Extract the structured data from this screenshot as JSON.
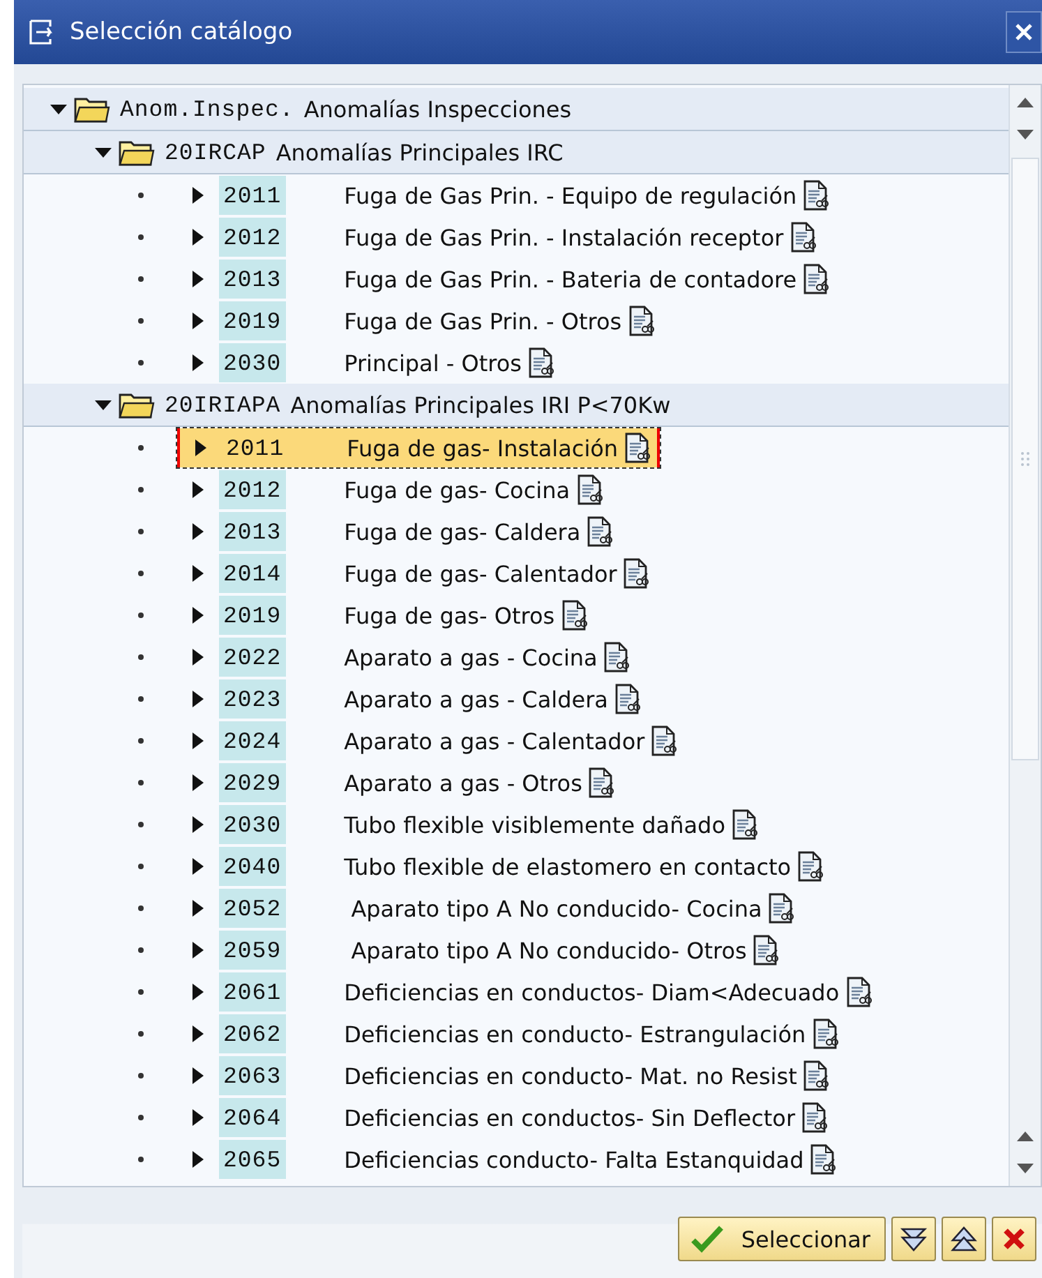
{
  "window": {
    "title": "Selección catálogo"
  },
  "tree": [
    {
      "code": "Anom.Inspec.",
      "text": "Anomalías Inspecciones",
      "expanded": true,
      "selected": false,
      "children": [
        {
          "code": "20IRCAP",
          "text": "Anomalías Principales IRC",
          "expanded": true,
          "selected": false,
          "children": [
            {
              "code": "2011",
              "text": "Fuga de Gas Prin. - Equipo de regulación",
              "expanded": false,
              "selected": false
            },
            {
              "code": "2012",
              "text": "Fuga de Gas Prin. - Instalación receptor",
              "expanded": false,
              "selected": false
            },
            {
              "code": "2013",
              "text": "Fuga de Gas Prin. - Bateria de contadore",
              "expanded": false,
              "selected": false
            },
            {
              "code": "2019",
              "text": "Fuga de Gas Prin. - Otros",
              "expanded": false,
              "selected": false
            },
            {
              "code": "2030",
              "text": "Principal - Otros",
              "expanded": false,
              "selected": false
            }
          ]
        },
        {
          "code": "20IRIAPA",
          "text": "Anomalías Principales IRI P<70Kw",
          "expanded": true,
          "selected": false,
          "children": [
            {
              "code": "2011",
              "text": "Fuga de gas- Instalación",
              "expanded": false,
              "selected": true
            },
            {
              "code": "2012",
              "text": "Fuga de gas- Cocina",
              "expanded": false,
              "selected": false
            },
            {
              "code": "2013",
              "text": "Fuga de gas- Caldera",
              "expanded": false,
              "selected": false
            },
            {
              "code": "2014",
              "text": "Fuga de gas- Calentador",
              "expanded": false,
              "selected": false
            },
            {
              "code": "2019",
              "text": "Fuga de gas- Otros",
              "expanded": false,
              "selected": false
            },
            {
              "code": "2022",
              "text": "Aparato a gas - Cocina",
              "expanded": false,
              "selected": false
            },
            {
              "code": "2023",
              "text": "Aparato a gas - Caldera",
              "expanded": false,
              "selected": false
            },
            {
              "code": "2024",
              "text": "Aparato a gas - Calentador",
              "expanded": false,
              "selected": false
            },
            {
              "code": "2029",
              "text": "Aparato a gas - Otros",
              "expanded": false,
              "selected": false
            },
            {
              "code": "2030",
              "text": "Tubo flexible visiblemente dañado",
              "expanded": false,
              "selected": false
            },
            {
              "code": "2040",
              "text": "Tubo flexible de elastomero en contacto",
              "expanded": false,
              "selected": false
            },
            {
              "code": "2052",
              "text": " Aparato tipo A No conducido- Cocina",
              "expanded": false,
              "selected": false
            },
            {
              "code": "2059",
              "text": " Aparato tipo A No conducido- Otros",
              "expanded": false,
              "selected": false
            },
            {
              "code": "2061",
              "text": "Deficiencias en conductos- Diam<Adecuado",
              "expanded": false,
              "selected": false
            },
            {
              "code": "2062",
              "text": "Deficiencias en conducto- Estrangulación",
              "expanded": false,
              "selected": false
            },
            {
              "code": "2063",
              "text": "Deficiencias en conducto- Mat. no Resist",
              "expanded": false,
              "selected": false
            },
            {
              "code": "2064",
              "text": "Deficiencias en conductos- Sin Deflector",
              "expanded": false,
              "selected": false
            },
            {
              "code": "2065",
              "text": "Deficiencias conducto- Falta Estanquidad",
              "expanded": false,
              "selected": false
            }
          ]
        }
      ]
    }
  ],
  "buttons": {
    "select": "Seleccionar"
  }
}
